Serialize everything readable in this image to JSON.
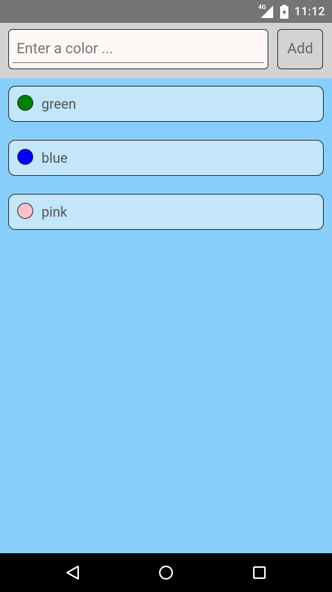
{
  "status_bar": {
    "network": "4G",
    "time": "11:12"
  },
  "input": {
    "placeholder": "Enter a color ..."
  },
  "add_button": {
    "label": "Add"
  },
  "colors": [
    {
      "label": "green",
      "color": "#008000"
    },
    {
      "label": "blue",
      "color": "#0000FF"
    },
    {
      "label": "pink",
      "color": "#FFC0CB"
    }
  ],
  "nav_icons": [
    "back-icon",
    "home-icon",
    "recents-icon"
  ],
  "theme": {
    "background": "#87CEFA",
    "panel": "#D3D3D3",
    "item": "#C3E6FB"
  }
}
